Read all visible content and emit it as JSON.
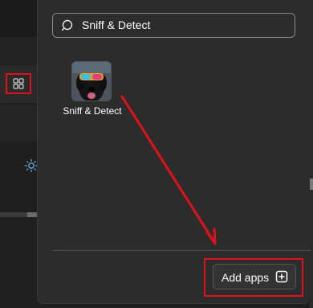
{
  "search": {
    "value": "Sniff & Detect",
    "icon": "search-icon"
  },
  "apps": [
    {
      "label": "Sniff & Detect",
      "icon": "dog-with-goggles-avatar"
    }
  ],
  "footer": {
    "add_apps_label": "Add apps",
    "add_icon": "plus-square-icon"
  },
  "colors": {
    "panel": "#2c2c2c",
    "highlight": "#e0111b",
    "annotation_arrow": "#e0111b"
  }
}
